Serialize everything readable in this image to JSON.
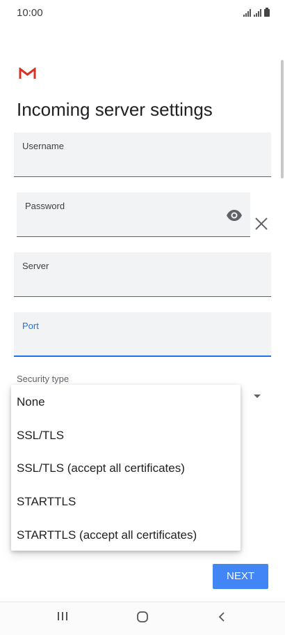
{
  "status_bar": {
    "time": "10:00"
  },
  "app": {
    "title": "Incoming server settings",
    "brand_color": "#d93025",
    "accent_color": "#1a73e8"
  },
  "form": {
    "username": {
      "label": "Username",
      "value": ""
    },
    "password": {
      "label": "Password",
      "value": ""
    },
    "server": {
      "label": "Server",
      "value": ""
    },
    "port": {
      "label": "Port",
      "value": ""
    },
    "security_type": {
      "label": "Security type"
    }
  },
  "security_menu": {
    "items": [
      "None",
      "SSL/TLS",
      "SSL/TLS (accept all certificates)",
      "STARTTLS",
      "STARTTLS (accept all certificates)"
    ]
  },
  "actions": {
    "next_label": "NEXT",
    "next_color": "#4285f4"
  },
  "icons": {
    "logo": "gmail-icon",
    "password_toggle": "eye-icon",
    "clear": "close-icon",
    "nav": [
      "recent-apps-icon",
      "home-icon",
      "back-icon"
    ]
  }
}
